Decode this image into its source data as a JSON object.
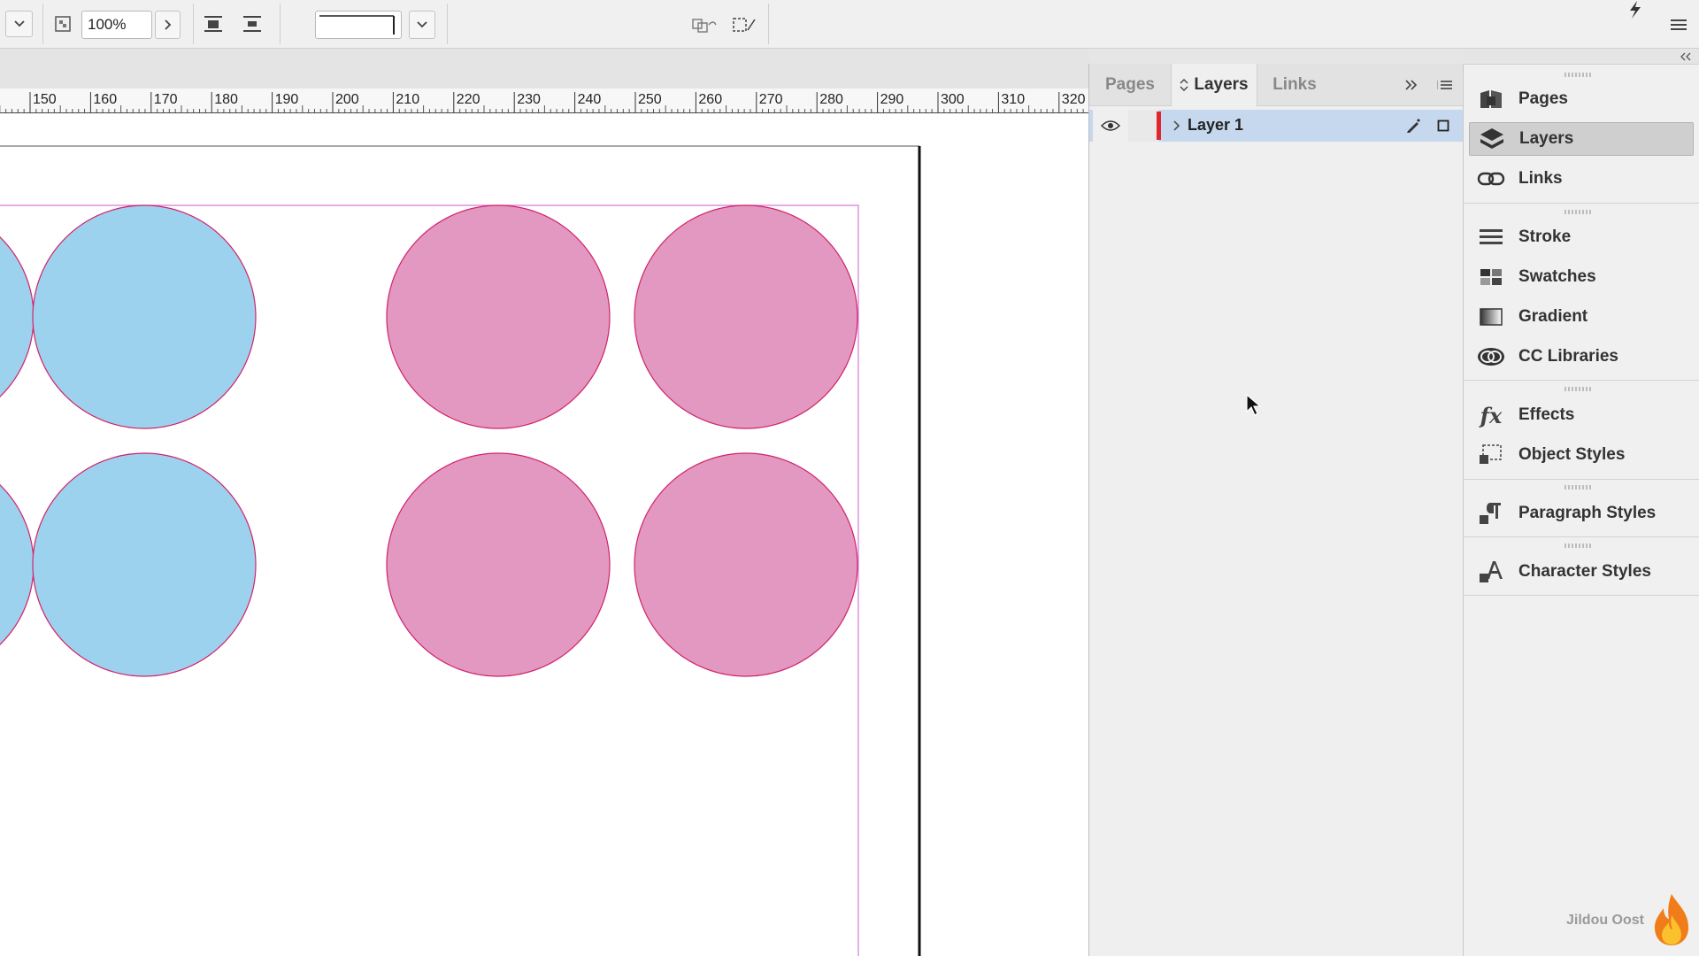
{
  "toolbar": {
    "zoom_value": "100%",
    "stroke_weight_value": ""
  },
  "ruler": {
    "ticks": [
      "150",
      "160",
      "170",
      "180",
      "190",
      "200",
      "210",
      "220",
      "230",
      "240",
      "250",
      "260",
      "270",
      "280",
      "290",
      "300",
      "310",
      "320"
    ]
  },
  "canvas": {
    "fill_colors": {
      "blue": "#9dd2ef",
      "pink": "#e298c0",
      "stroke": "#d2236a",
      "margin_guide": "#d57adb"
    }
  },
  "layers_panel": {
    "tabs": [
      "Pages",
      "Layers",
      "Links"
    ],
    "active_tab": "Layers",
    "layers": [
      {
        "name": "Layer 1",
        "color": "#e0262d",
        "visible": true
      }
    ]
  },
  "dock": {
    "items": [
      {
        "label": "Pages",
        "icon": "pages-icon"
      },
      {
        "label": "Layers",
        "icon": "layers-icon",
        "active": true
      },
      {
        "label": "Links",
        "icon": "links-icon"
      },
      {
        "label": "Stroke",
        "icon": "stroke-icon"
      },
      {
        "label": "Swatches",
        "icon": "swatches-icon"
      },
      {
        "label": "Gradient",
        "icon": "gradient-icon"
      },
      {
        "label": "CC Libraries",
        "icon": "cc-libraries-icon"
      },
      {
        "label": "Effects",
        "icon": "effects-icon"
      },
      {
        "label": "Object Styles",
        "icon": "object-styles-icon"
      },
      {
        "label": "Paragraph Styles",
        "icon": "paragraph-styles-icon"
      },
      {
        "label": "Character Styles",
        "icon": "character-styles-icon"
      }
    ]
  },
  "watermark": {
    "text": "Jildou Oost"
  }
}
